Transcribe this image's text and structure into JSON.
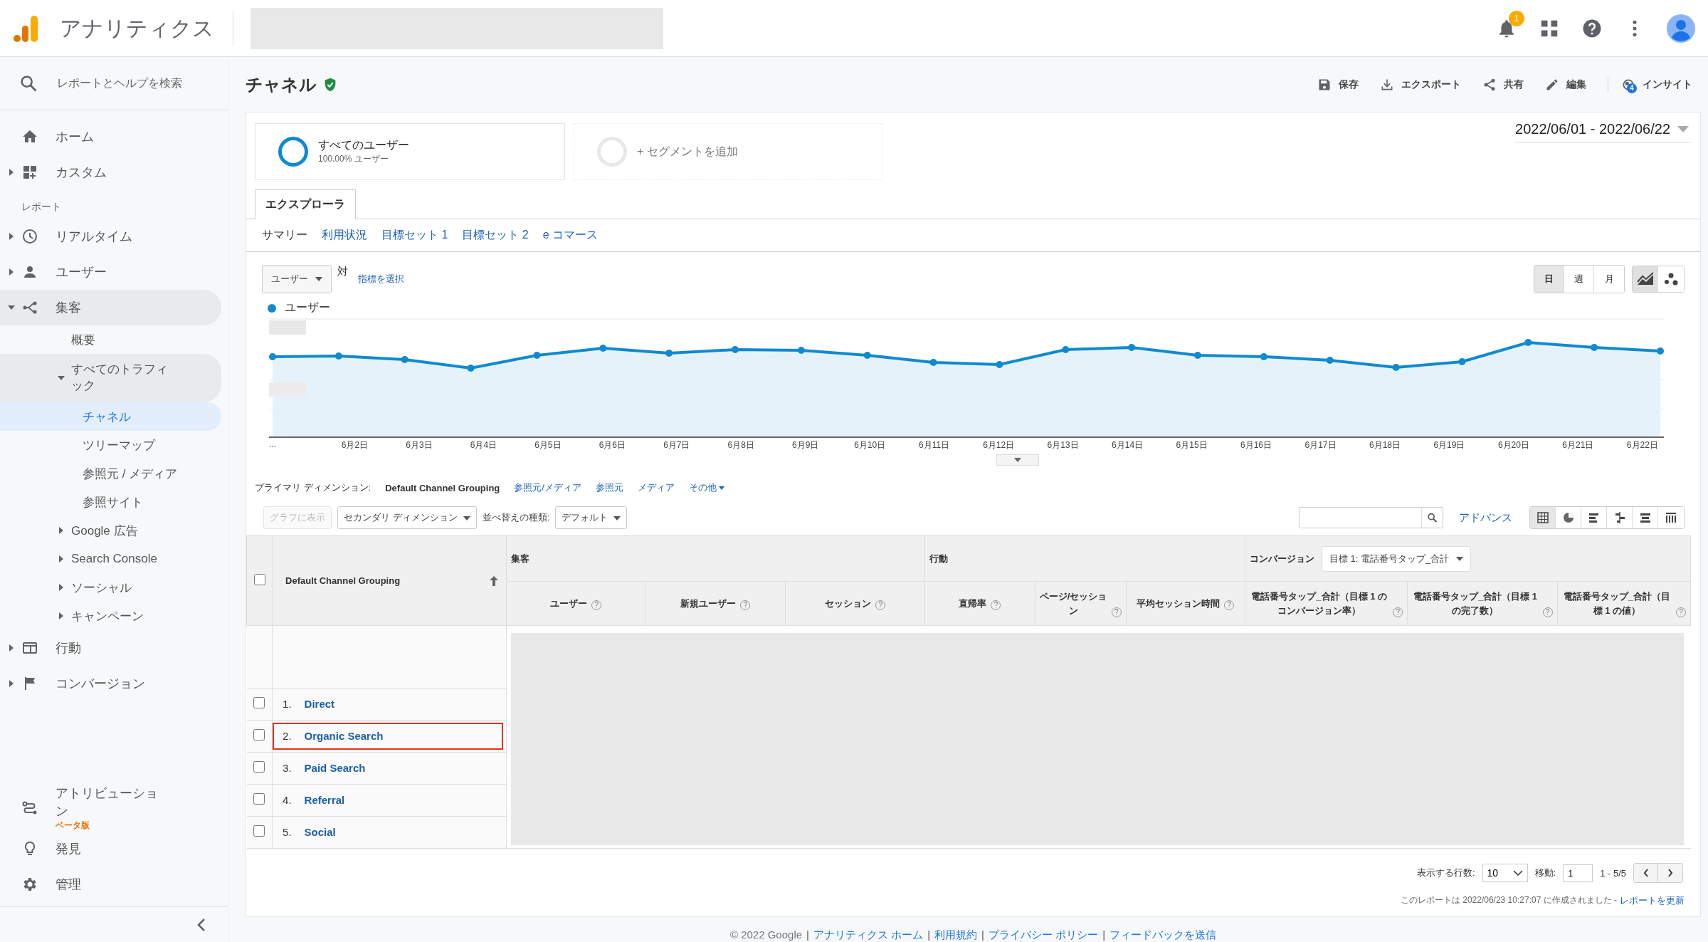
{
  "app": {
    "title": "アナリティクス",
    "notification_count": "1"
  },
  "sidebar": {
    "search_placeholder": "レポートとヘルプを検索",
    "items": [
      {
        "kind": "nav",
        "label": "ホーム",
        "selected": false
      },
      {
        "kind": "nav",
        "label": "カスタム",
        "expanded": false,
        "selected": false
      },
      {
        "kind": "heading",
        "label": "レポート"
      },
      {
        "kind": "nav",
        "label": "リアルタイム",
        "expanded": false,
        "selected": false
      },
      {
        "kind": "nav",
        "label": "ユーザー",
        "expanded": false,
        "selected": false
      },
      {
        "kind": "nav",
        "label": "集客",
        "expanded": true,
        "selected": false,
        "children": [
          {
            "label": "概要",
            "selected": false
          },
          {
            "label": "すべてのトラフィック",
            "expanded": true,
            "selected": false,
            "children": [
              {
                "label": "チャネル",
                "selected": true
              },
              {
                "label": "ツリーマップ",
                "selected": false
              },
              {
                "label": "参照元 / メディア",
                "selected": false
              },
              {
                "label": "参照サイト",
                "selected": false
              }
            ]
          },
          {
            "label": "Google 広告",
            "expanded": false,
            "selected": false
          },
          {
            "label": "Search Console",
            "expanded": false,
            "selected": false
          },
          {
            "label": "ソーシャル",
            "expanded": false,
            "selected": false
          },
          {
            "label": "キャンペーン",
            "expanded": false,
            "selected": false
          }
        ]
      },
      {
        "kind": "nav",
        "label": "行動",
        "expanded": false,
        "selected": false
      },
      {
        "kind": "nav",
        "label": "コンバージョン",
        "expanded": false,
        "selected": false
      }
    ],
    "bottom_items": [
      {
        "label": "アトリビューション",
        "badge": "ベータ版"
      },
      {
        "label": "発見"
      },
      {
        "label": "管理"
      }
    ]
  },
  "page": {
    "title": "チャネル",
    "verified": true,
    "actions": [
      {
        "label": "保存"
      },
      {
        "label": "エクスポート"
      },
      {
        "label": "共有"
      },
      {
        "label": "編集"
      },
      {
        "label": "インサイト",
        "badge": "4"
      }
    ]
  },
  "segments": [
    {
      "kind": "active",
      "name": "すべてのユーザー",
      "detail": "100.00% ユーザー"
    },
    {
      "kind": "add",
      "name": "+ セグメントを追加"
    }
  ],
  "date_range": "2022/06/01 - 2022/06/22",
  "tabs": [
    {
      "label": "エクスプローラ"
    }
  ],
  "subtabs": [
    {
      "label": "サマリー",
      "selected": true
    },
    {
      "label": "利用状況",
      "selected": false
    },
    {
      "label": "目標セット 1",
      "selected": false
    },
    {
      "label": "目標セット 2",
      "selected": false
    },
    {
      "label": "e コマース",
      "selected": false
    }
  ],
  "chart_controls": {
    "metric": "ユーザー",
    "vs_label": "対",
    "select_metric": "指標を選択",
    "granularity": [
      {
        "label": "日",
        "selected": true
      },
      {
        "label": "週",
        "selected": false
      },
      {
        "label": "月",
        "selected": false
      }
    ],
    "chart_types": [
      {
        "selected": true
      },
      {
        "selected": false
      }
    ]
  },
  "chart": {
    "legend": "ユーザー",
    "x_labels": [
      "...",
      "6月2日",
      "6月3日",
      "6月4日",
      "6月5日",
      "6月6日",
      "6月7日",
      "6月8日",
      "6月9日",
      "6月10日",
      "6月11日",
      "6月12日",
      "6月13日",
      "6月14日",
      "6月15日",
      "6月16日",
      "6月17日",
      "6月18日",
      "6月19日",
      "6月20日",
      "6月21日",
      "6月22日"
    ]
  },
  "dimension_bar": {
    "label": "プライマリ ディメンション:",
    "options": [
      {
        "label": "Default Channel Grouping",
        "selected": true,
        "kind": "link"
      },
      {
        "label": "参照元/メディア",
        "selected": false,
        "kind": "link"
      },
      {
        "label": "参照元",
        "selected": false,
        "kind": "link"
      },
      {
        "label": "メディア",
        "selected": false,
        "kind": "link"
      },
      {
        "label": "その他",
        "selected": false,
        "kind": "menu"
      }
    ]
  },
  "toolbar": {
    "plot_button": {
      "label": "グラフに表示",
      "disabled": true
    },
    "secondary_dimension": "セカンダリ ディメンション",
    "sort_label": "並べ替えの種類:",
    "sort_value": "デフォルト",
    "advanced": "アドバンス",
    "views": [
      {
        "selected": true
      },
      {
        "selected": false
      },
      {
        "selected": false
      },
      {
        "selected": false
      },
      {
        "selected": false
      },
      {
        "selected": false
      }
    ]
  },
  "table": {
    "select_all_checked": false,
    "dimension_column": "Default Channel Grouping",
    "groups": [
      {
        "label": "集客",
        "columns": [
          {
            "label": "ユーザー",
            "help": "?"
          },
          {
            "label": "新規ユーザー",
            "help": "?"
          },
          {
            "label": "セッション",
            "help": "?"
          }
        ]
      },
      {
        "label": "行動",
        "columns": [
          {
            "label": "直帰率",
            "help": "?"
          },
          {
            "label": "ページ/セッション",
            "help": "?"
          },
          {
            "label": "平均セッション時間",
            "help": "?"
          }
        ]
      },
      {
        "label": "コンバージョン",
        "goal": "目標 1: 電話番号タップ_合計",
        "columns": [
          {
            "label": "電話番号タップ_合計（目標 1 のコンバージョン率）",
            "help": "?"
          },
          {
            "label": "電話番号タップ_合計（目標 1 の完了数）",
            "help": "?"
          },
          {
            "label": "電話番号タップ_合計（目標 1 の値）",
            "help": "?"
          }
        ]
      }
    ],
    "rows": [
      {
        "index": "1.",
        "label": "Direct",
        "checked": false,
        "highlighted": false
      },
      {
        "index": "2.",
        "label": "Organic Search",
        "checked": false,
        "highlighted": true
      },
      {
        "index": "3.",
        "label": "Paid Search",
        "checked": false,
        "highlighted": false
      },
      {
        "index": "4.",
        "label": "Referral",
        "checked": false,
        "highlighted": false
      },
      {
        "index": "5.",
        "label": "Social",
        "checked": false,
        "highlighted": false
      }
    ]
  },
  "pagination": {
    "rows_label": "表示する行数:",
    "rows_value": "10",
    "goto_label": "移動:",
    "goto_value": "1",
    "range": "1 - 5/5"
  },
  "report_note": {
    "text": "このレポートは 2022/06/23 10:27:07 に作成されました -",
    "link": "レポートを更新"
  },
  "footer": {
    "copyright": "© 2022 Google",
    "links": [
      {
        "separator": "|",
        "label": "アナリティクス ホーム"
      },
      {
        "separator": "|",
        "label": "利用規約"
      },
      {
        "separator": "|",
        "label": "プライバシー ポリシー"
      },
      {
        "separator": "|",
        "label": "フィードバックを送信"
      }
    ]
  }
}
